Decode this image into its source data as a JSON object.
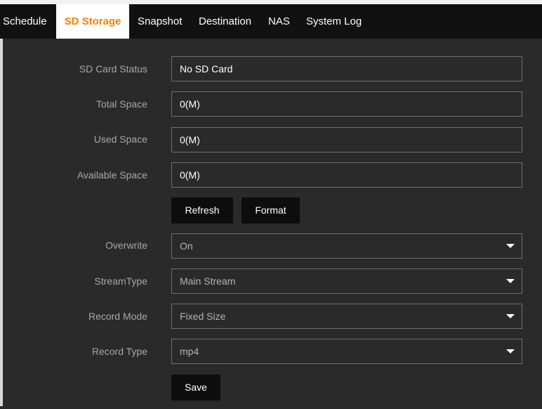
{
  "tabs": {
    "schedule": "Schedule",
    "sd_storage": "SD Storage",
    "snapshot": "Snapshot",
    "destination": "Destination",
    "nas": "NAS",
    "system_log": "System Log"
  },
  "form": {
    "sd_card_status": {
      "label": "SD Card Status",
      "value": "No SD Card"
    },
    "total_space": {
      "label": "Total Space",
      "value": "0(M)"
    },
    "used_space": {
      "label": "Used Space",
      "value": "0(M)"
    },
    "available_space": {
      "label": "Available Space",
      "value": "0(M)"
    },
    "refresh_label": "Refresh",
    "format_label": "Format",
    "overwrite": {
      "label": "Overwrite",
      "value": "On"
    },
    "stream_type": {
      "label": "StreamType",
      "value": "Main Stream"
    },
    "record_mode": {
      "label": "Record Mode",
      "value": "Fixed Size"
    },
    "record_type": {
      "label": "Record Type",
      "value": "mp4"
    },
    "save_label": "Save"
  },
  "colors": {
    "accent": "#ff7f00",
    "tabbar_bg": "#111111",
    "panel_bg": "#2a2a2a",
    "button_bg": "#0d0d0d"
  },
  "icons": {
    "dropdown": "chevron-down-icon"
  }
}
